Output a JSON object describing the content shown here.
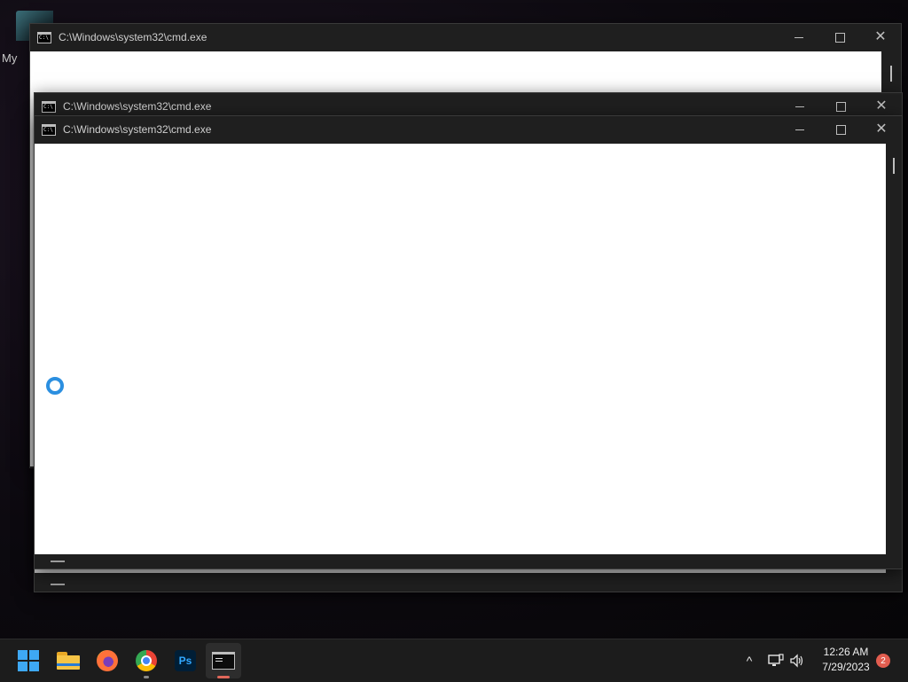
{
  "desktop": {
    "icon_label": "My"
  },
  "windows": [
    {
      "title": "C:\\Windows\\system32\\cmd.exe"
    },
    {
      "title": "C:\\Windows\\system32\\cmd.exe"
    },
    {
      "title": "C:\\Windows\\system32\\cmd.exe"
    }
  ],
  "taskbar": {
    "apps": [
      {
        "name": "start",
        "icon": "windows-logo-icon"
      },
      {
        "name": "file-explorer",
        "icon": "folder-icon"
      },
      {
        "name": "firefox",
        "icon": "firefox-icon"
      },
      {
        "name": "chrome",
        "icon": "chrome-icon"
      },
      {
        "name": "photoshop",
        "icon": "photoshop-icon",
        "label": "Ps"
      },
      {
        "name": "command-prompt",
        "icon": "terminal-icon",
        "active": true
      }
    ],
    "tray": {
      "chevron": "^",
      "time": "12:26 AM",
      "date": "7/29/2023",
      "notification_count": "2"
    }
  },
  "colors": {
    "accent": "#3ea8f4",
    "titlebar": "#1f1f1f",
    "active_indicator": "#e0675a",
    "spinner": "#2b8fe0"
  }
}
